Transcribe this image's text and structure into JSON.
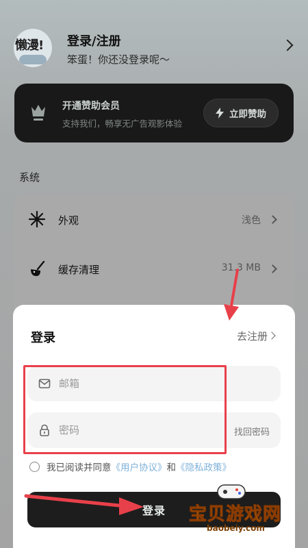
{
  "profile": {
    "avatar_text": "懒漫!",
    "title": "登录/注册",
    "subtitle": "笨蛋！你还没登录呢～"
  },
  "sponsor": {
    "title": "开通赞助会员",
    "subtitle": "支持我们，畅享无广告观影体验",
    "button": "立即赞助",
    "icon": "crown-icon"
  },
  "system": {
    "section_label": "系统",
    "items": [
      {
        "label": "外观",
        "value": "浅色",
        "icon": "appearance-icon"
      },
      {
        "label": "缓存清理",
        "value": "31.3 MB",
        "icon": "broom-icon"
      }
    ]
  },
  "login": {
    "title": "登录",
    "register_link": "去注册",
    "email_placeholder": "邮箱",
    "password_placeholder": "密码",
    "forgot": "找回密码",
    "agree_prefix": "我已阅读并同意",
    "user_agreement": "《用户协议》",
    "and": "和",
    "privacy_policy": "《隐私政策》",
    "submit": "登录"
  },
  "watermark": {
    "text": "宝贝游戏网",
    "url": "baobeiy.com"
  },
  "colors": {
    "annotation": "#e8404a",
    "link": "#7fb2da",
    "dark": "#1d1d1d"
  }
}
